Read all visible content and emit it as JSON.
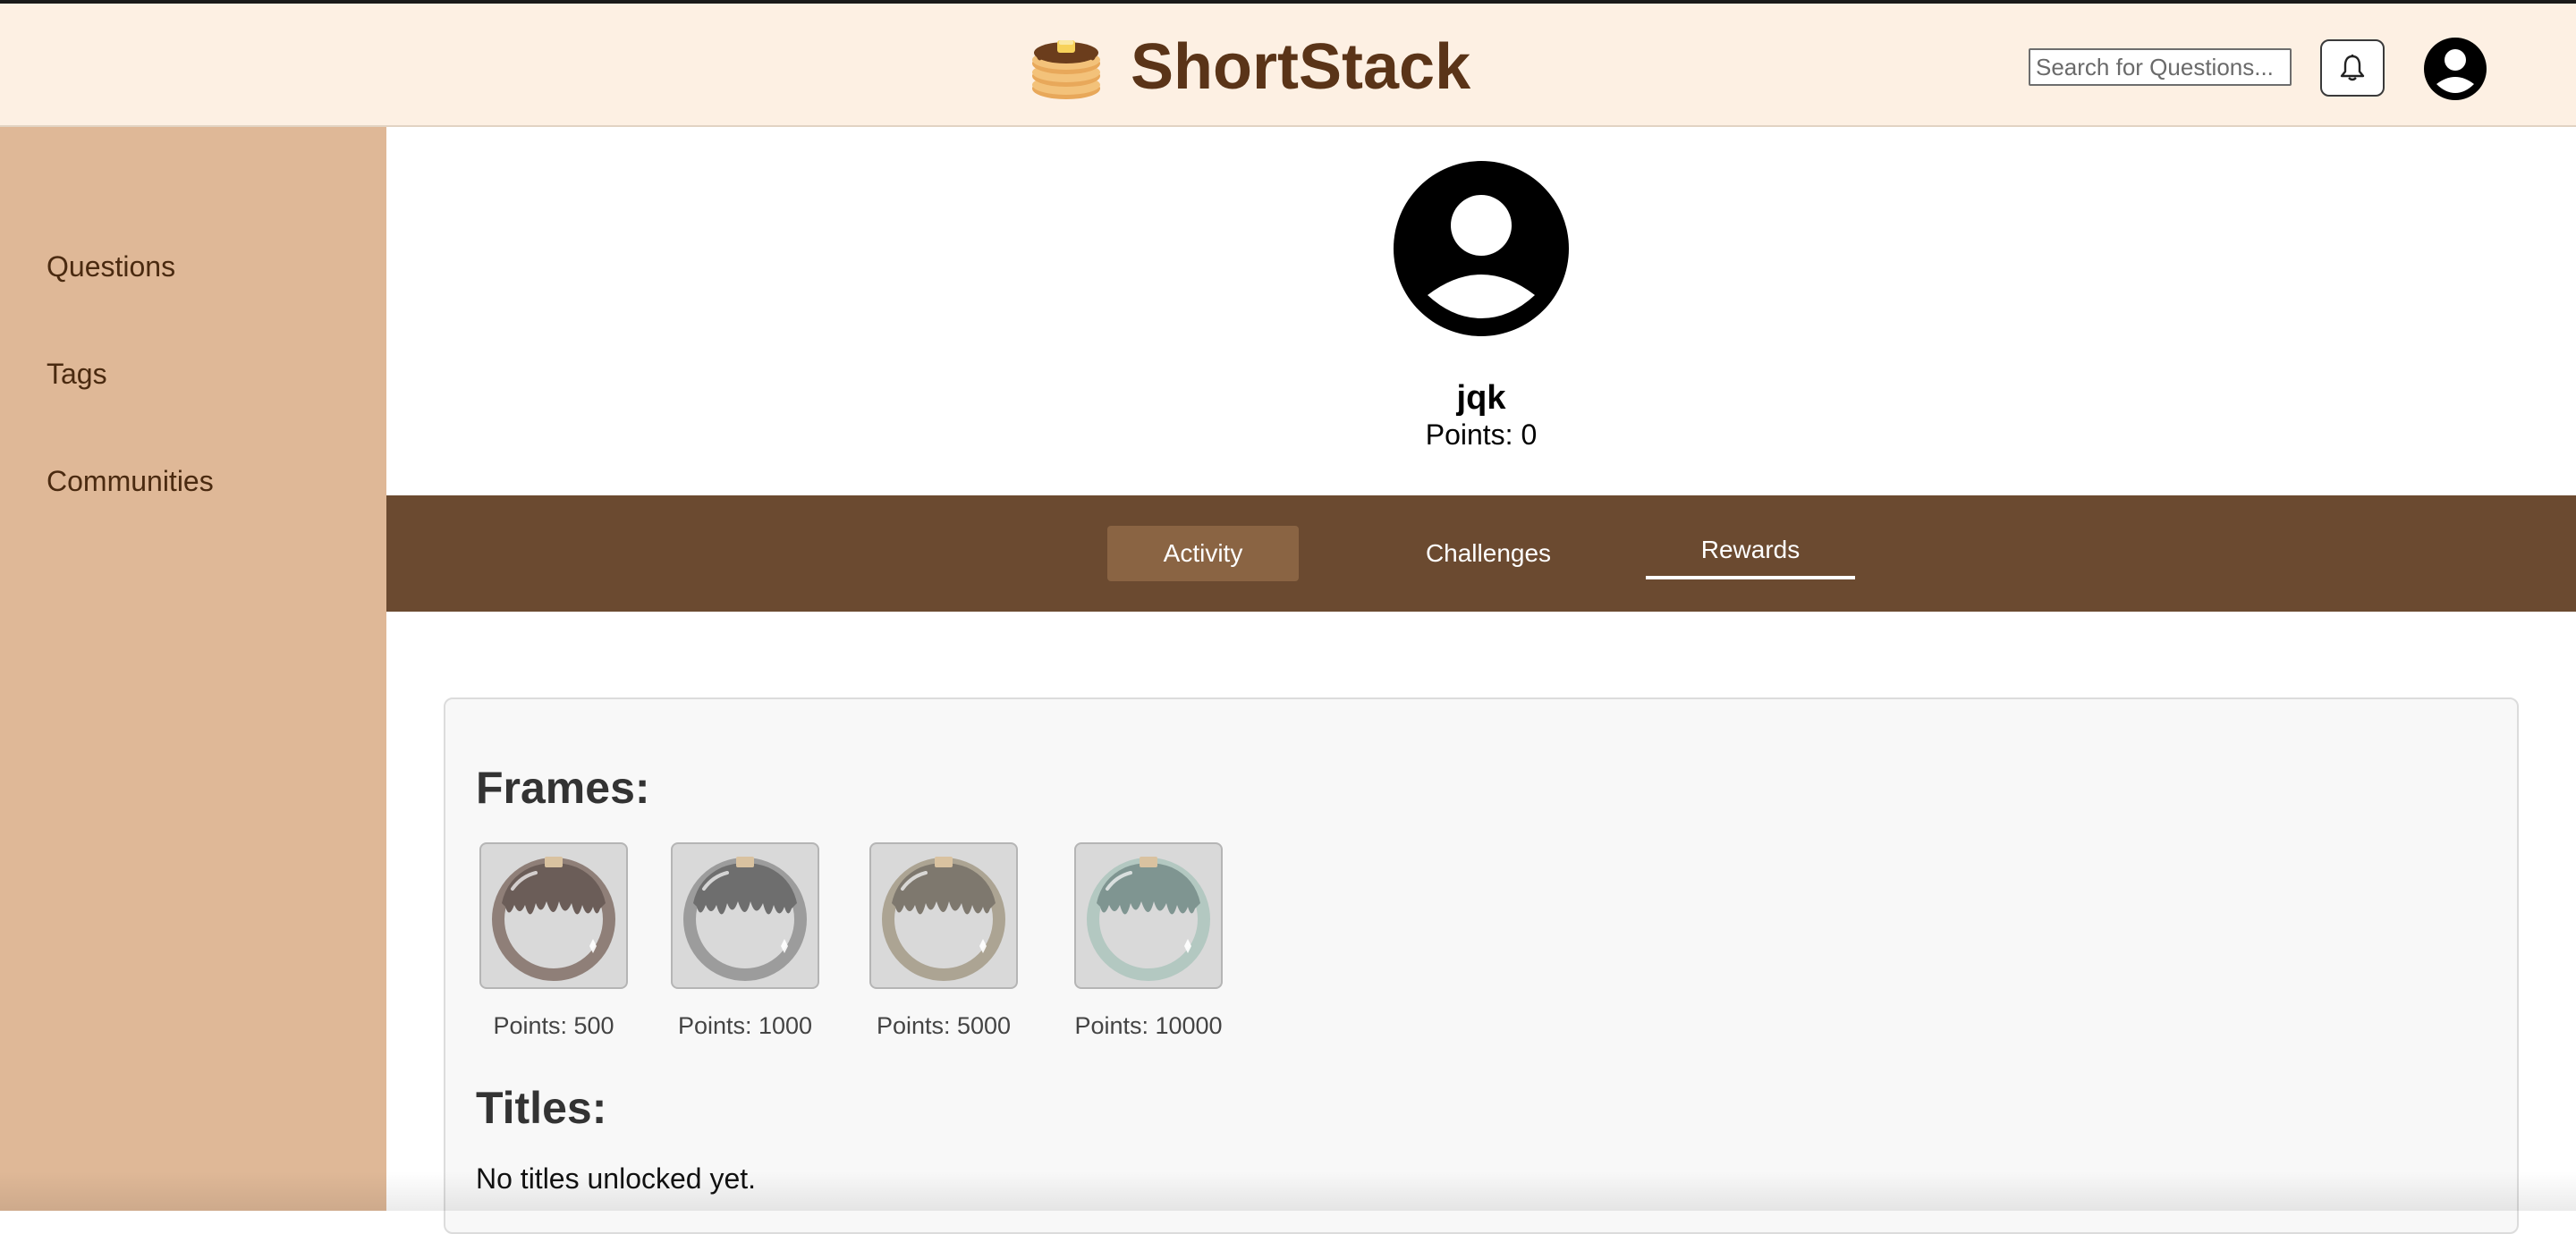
{
  "header": {
    "app_name": "ShortStack",
    "logo_icon": "pancake-stack-icon",
    "search_placeholder": "Search for Questions...",
    "search_value": "",
    "notification_icon": "bell-icon",
    "avatar_icon": "user-avatar-icon"
  },
  "sidebar": {
    "items": [
      {
        "label": "Questions"
      },
      {
        "label": "Tags"
      },
      {
        "label": "Communities"
      }
    ]
  },
  "profile": {
    "username": "jqk",
    "points_text": "Points: 0",
    "avatar_icon": "user-avatar-icon"
  },
  "tabs": [
    {
      "label": "Activity"
    },
    {
      "label": "Challenges"
    },
    {
      "label": "Rewards",
      "selected": true
    }
  ],
  "rewards": {
    "frames_heading": "Frames:",
    "frames": [
      {
        "label": "Points: 500",
        "ring_color": "#8f7f78",
        "drip_color": "#6b5d58"
      },
      {
        "label": "Points: 1000",
        "ring_color": "#9c9c9c",
        "drip_color": "#6e6e6e"
      },
      {
        "label": "Points: 5000",
        "ring_color": "#aca493",
        "drip_color": "#7e786e"
      },
      {
        "label": "Points: 10000",
        "ring_color": "#b3c8c1",
        "drip_color": "#7f9591"
      }
    ],
    "titles_heading": "Titles:",
    "titles_empty": "No titles unlocked yet."
  },
  "colors": {
    "header_bg": "#fdf0e3",
    "brand_text": "#5a3418",
    "sidebar_bg": "#dfb897",
    "tabs_bg": "#6b4a30",
    "active_tab_bg": "#8a6443",
    "panel_bg": "#f8f8f8"
  }
}
